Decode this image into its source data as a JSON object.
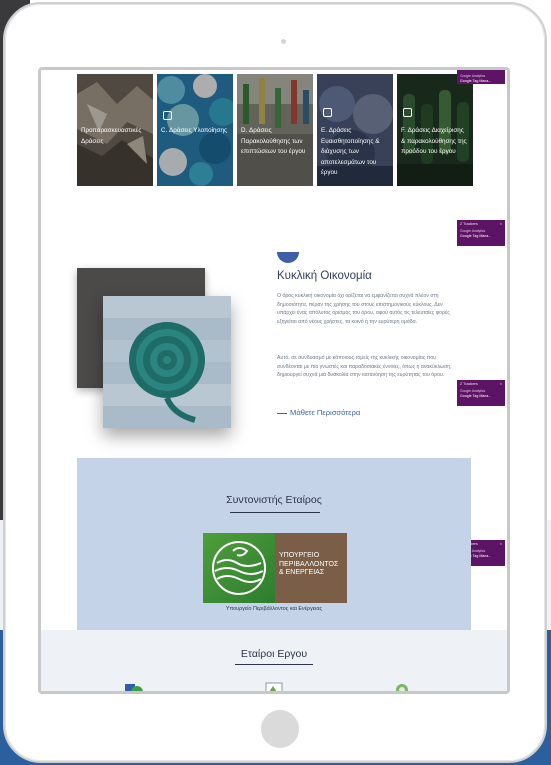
{
  "cards": [
    {
      "label": "Προπαρασκευαστικές Δράσεις",
      "icon": "document-icon"
    },
    {
      "label": "C. Δράσεις Υλοποίησης",
      "icon": "document-icon"
    },
    {
      "label": "D. Δράσεις Παρακολούθησης των επιπτώσεων του έργου",
      "icon": "document-icon"
    },
    {
      "label": "E. Δράσεις Ευαισθητοποίησης & διάχυσης των αποτελεσμάτων του έργου",
      "icon": "document-icon"
    },
    {
      "label": "F. Δράσεις Διαχείρισης & παρακολούθησης της προόδου του έργου",
      "icon": "document-icon"
    }
  ],
  "badge": {
    "line1": "Google Tag Mana...",
    "line2": "2 Trackers",
    "line3": "Google Analytics",
    "close": "×"
  },
  "circular": {
    "title": "Κυκλική Οικονομία",
    "para1": "Ο όρος κυκλική οικονομία όχι ορίζεται να εμφανίζεται συχνά πλέον στη δημοσιότητα, πέραν της χρήσης του στους επιστημονικούς κύκλους. Δεν υπάρχει ένας απόλυτος ορισμός του όρου, αφού αυτός τις τελευταίες φορές εξηγείται από νέους χρήστες, τα κοινό ή την ευρύτερη ομάδα.",
    "para2": "Αυτό, σε συνδυασμό με κάποιους τομείς της κυκλικής οικονομίας που συνδέονται με πιο γνωστές και παραδοσιακές έννοιες, όπως η ανακύκλωση, δημιουργεί συχνά μια δυσκολία στην κατανόηση της ευρύτητας του όρου.",
    "link": "Μάθετε Περισσότερα"
  },
  "coordinator": {
    "title": "Συντονιστής Εταίρος",
    "logo_text_1": "ΥΠΟΥΡΓΕΙΟ",
    "logo_text_2": "ΠΕΡΙΒΑΛΛΟΝΤΟΣ",
    "logo_text_3": "& ΕΝΕΡΓΕΙΑΣ",
    "caption": "Υπουργείο Περιβάλλοντος και Ενέργειας"
  },
  "partners": {
    "title": "Εταίροι Εργου"
  },
  "colors": {
    "badge": "#5e1466",
    "accent": "#3e64ad",
    "panel": "#c5d3e8"
  }
}
